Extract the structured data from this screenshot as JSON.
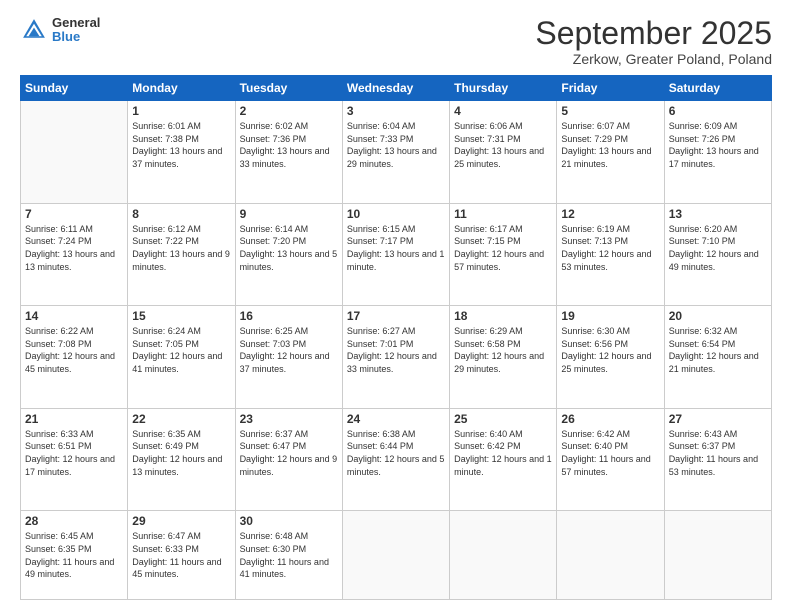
{
  "header": {
    "logo": {
      "general": "General",
      "blue": "Blue"
    },
    "title": "September 2025",
    "subtitle": "Zerkow, Greater Poland, Poland"
  },
  "weekdays": [
    "Sunday",
    "Monday",
    "Tuesday",
    "Wednesday",
    "Thursday",
    "Friday",
    "Saturday"
  ],
  "weeks": [
    [
      {
        "empty": true
      },
      {
        "day": "1",
        "sunrise": "6:01 AM",
        "sunset": "7:38 PM",
        "daylight": "13 hours and 37 minutes."
      },
      {
        "day": "2",
        "sunrise": "6:02 AM",
        "sunset": "7:36 PM",
        "daylight": "13 hours and 33 minutes."
      },
      {
        "day": "3",
        "sunrise": "6:04 AM",
        "sunset": "7:33 PM",
        "daylight": "13 hours and 29 minutes."
      },
      {
        "day": "4",
        "sunrise": "6:06 AM",
        "sunset": "7:31 PM",
        "daylight": "13 hours and 25 minutes."
      },
      {
        "day": "5",
        "sunrise": "6:07 AM",
        "sunset": "7:29 PM",
        "daylight": "13 hours and 21 minutes."
      },
      {
        "day": "6",
        "sunrise": "6:09 AM",
        "sunset": "7:26 PM",
        "daylight": "13 hours and 17 minutes."
      }
    ],
    [
      {
        "day": "7",
        "sunrise": "6:11 AM",
        "sunset": "7:24 PM",
        "daylight": "13 hours and 13 minutes."
      },
      {
        "day": "8",
        "sunrise": "6:12 AM",
        "sunset": "7:22 PM",
        "daylight": "13 hours and 9 minutes."
      },
      {
        "day": "9",
        "sunrise": "6:14 AM",
        "sunset": "7:20 PM",
        "daylight": "13 hours and 5 minutes."
      },
      {
        "day": "10",
        "sunrise": "6:15 AM",
        "sunset": "7:17 PM",
        "daylight": "13 hours and 1 minute."
      },
      {
        "day": "11",
        "sunrise": "6:17 AM",
        "sunset": "7:15 PM",
        "daylight": "12 hours and 57 minutes."
      },
      {
        "day": "12",
        "sunrise": "6:19 AM",
        "sunset": "7:13 PM",
        "daylight": "12 hours and 53 minutes."
      },
      {
        "day": "13",
        "sunrise": "6:20 AM",
        "sunset": "7:10 PM",
        "daylight": "12 hours and 49 minutes."
      }
    ],
    [
      {
        "day": "14",
        "sunrise": "6:22 AM",
        "sunset": "7:08 PM",
        "daylight": "12 hours and 45 minutes."
      },
      {
        "day": "15",
        "sunrise": "6:24 AM",
        "sunset": "7:05 PM",
        "daylight": "12 hours and 41 minutes."
      },
      {
        "day": "16",
        "sunrise": "6:25 AM",
        "sunset": "7:03 PM",
        "daylight": "12 hours and 37 minutes."
      },
      {
        "day": "17",
        "sunrise": "6:27 AM",
        "sunset": "7:01 PM",
        "daylight": "12 hours and 33 minutes."
      },
      {
        "day": "18",
        "sunrise": "6:29 AM",
        "sunset": "6:58 PM",
        "daylight": "12 hours and 29 minutes."
      },
      {
        "day": "19",
        "sunrise": "6:30 AM",
        "sunset": "6:56 PM",
        "daylight": "12 hours and 25 minutes."
      },
      {
        "day": "20",
        "sunrise": "6:32 AM",
        "sunset": "6:54 PM",
        "daylight": "12 hours and 21 minutes."
      }
    ],
    [
      {
        "day": "21",
        "sunrise": "6:33 AM",
        "sunset": "6:51 PM",
        "daylight": "12 hours and 17 minutes."
      },
      {
        "day": "22",
        "sunrise": "6:35 AM",
        "sunset": "6:49 PM",
        "daylight": "12 hours and 13 minutes."
      },
      {
        "day": "23",
        "sunrise": "6:37 AM",
        "sunset": "6:47 PM",
        "daylight": "12 hours and 9 minutes."
      },
      {
        "day": "24",
        "sunrise": "6:38 AM",
        "sunset": "6:44 PM",
        "daylight": "12 hours and 5 minutes."
      },
      {
        "day": "25",
        "sunrise": "6:40 AM",
        "sunset": "6:42 PM",
        "daylight": "12 hours and 1 minute."
      },
      {
        "day": "26",
        "sunrise": "6:42 AM",
        "sunset": "6:40 PM",
        "daylight": "11 hours and 57 minutes."
      },
      {
        "day": "27",
        "sunrise": "6:43 AM",
        "sunset": "6:37 PM",
        "daylight": "11 hours and 53 minutes."
      }
    ],
    [
      {
        "day": "28",
        "sunrise": "6:45 AM",
        "sunset": "6:35 PM",
        "daylight": "11 hours and 49 minutes."
      },
      {
        "day": "29",
        "sunrise": "6:47 AM",
        "sunset": "6:33 PM",
        "daylight": "11 hours and 45 minutes."
      },
      {
        "day": "30",
        "sunrise": "6:48 AM",
        "sunset": "6:30 PM",
        "daylight": "11 hours and 41 minutes."
      },
      {
        "empty": true
      },
      {
        "empty": true
      },
      {
        "empty": true
      },
      {
        "empty": true
      }
    ]
  ]
}
